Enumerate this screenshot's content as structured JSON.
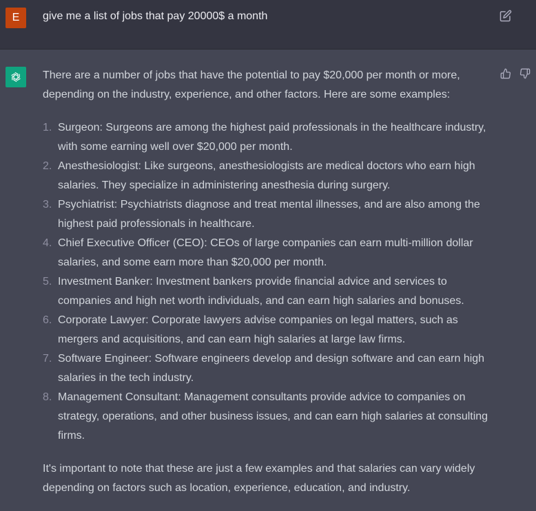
{
  "user": {
    "avatar_letter": "E",
    "message": "give me a list of jobs that pay 20000$ a month"
  },
  "assistant": {
    "intro": "There are a number of jobs that have the potential to pay $20,000 per month or more, depending on the industry, experience, and other factors. Here are some examples:",
    "items": [
      {
        "num": "1.",
        "text": "Surgeon: Surgeons are among the highest paid professionals in the healthcare industry, with some earning well over $20,000 per month."
      },
      {
        "num": "2.",
        "text": "Anesthesiologist: Like surgeons, anesthesiologists are medical doctors who earn high salaries. They specialize in administering anesthesia during surgery."
      },
      {
        "num": "3.",
        "text": "Psychiatrist: Psychiatrists diagnose and treat mental illnesses, and are also among the highest paid professionals in healthcare."
      },
      {
        "num": "4.",
        "text": "Chief Executive Officer (CEO): CEOs of large companies can earn multi-million dollar salaries, and some earn more than $20,000 per month."
      },
      {
        "num": "5.",
        "text": "Investment Banker: Investment bankers provide financial advice and services to companies and high net worth individuals, and can earn high salaries and bonuses."
      },
      {
        "num": "6.",
        "text": "Corporate Lawyer: Corporate lawyers advise companies on legal matters, such as mergers and acquisitions, and can earn high salaries at large law firms."
      },
      {
        "num": "7.",
        "text": "Software Engineer: Software engineers develop and design software and can earn high salaries in the tech industry."
      },
      {
        "num": "8.",
        "text": "Management Consultant: Management consultants provide advice to companies on strategy, operations, and other business issues, and can earn high salaries at consulting firms."
      }
    ],
    "outro": "It's important to note that these are just a few examples and that salaries can vary widely depending on factors such as location, experience, education, and industry."
  },
  "icons": {
    "edit": "edit-icon",
    "thumbs_up": "thumbs-up-icon",
    "thumbs_down": "thumbs-down-icon",
    "bot": "openai-logo-icon"
  },
  "colors": {
    "user_bg": "#343541",
    "assistant_bg": "#444654",
    "user_avatar": "#c1440e",
    "bot_avatar": "#10a37f"
  }
}
